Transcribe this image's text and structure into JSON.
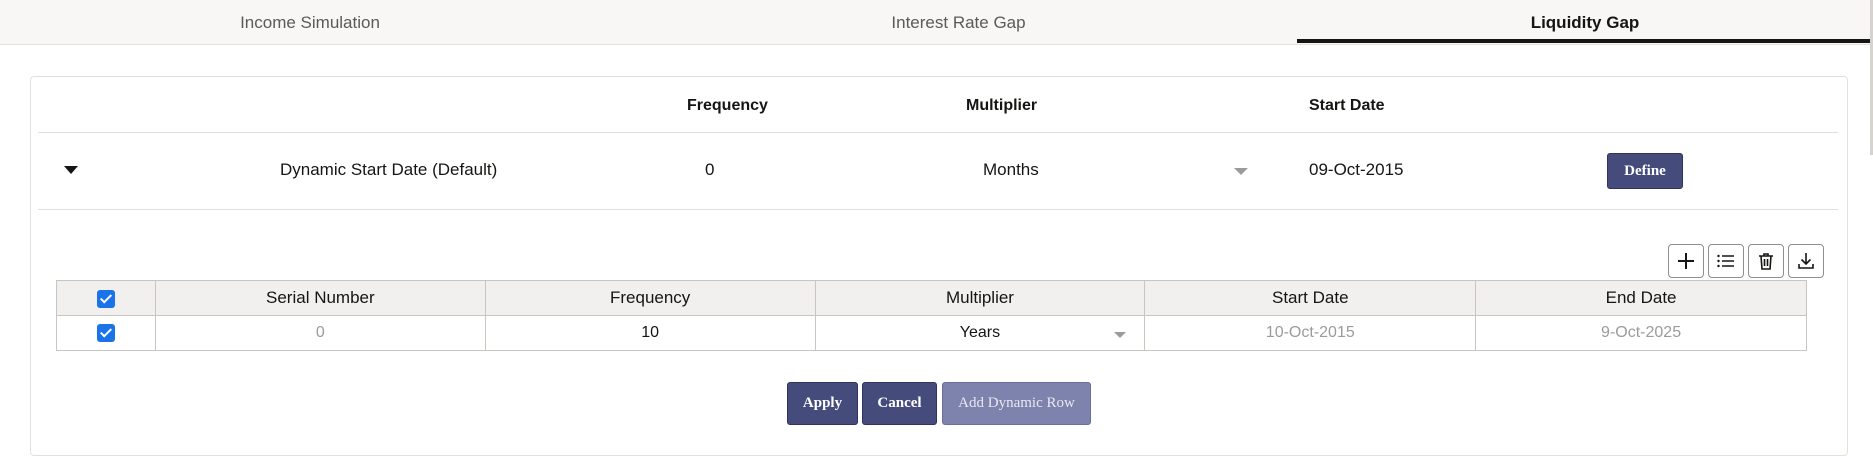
{
  "tabs": [
    {
      "label": "Income Simulation"
    },
    {
      "label": "Interest Rate Gap"
    },
    {
      "label": "Liquidity Gap"
    }
  ],
  "header": {
    "frequency": "Frequency",
    "multiplier": "Multiplier",
    "start_date": "Start Date"
  },
  "dynamic_row": {
    "label": "Dynamic Start Date (Default)",
    "frequency": "0",
    "multiplier": "Months",
    "start_date": "09-Oct-2015",
    "define_label": "Define"
  },
  "toolbar": {
    "add_icon": "plus-icon",
    "list_icon": "list-icon",
    "delete_icon": "trash-icon",
    "export_icon": "download-icon"
  },
  "grid": {
    "columns": [
      "Serial Number",
      "Frequency",
      "Multiplier",
      "Start Date",
      "End Date"
    ],
    "rows": [
      {
        "serial": "0",
        "frequency": "10",
        "multiplier": "Years",
        "start_date": "10-Oct-2015",
        "end_date": "9-Oct-2025"
      }
    ]
  },
  "actions": {
    "apply": "Apply",
    "cancel": "Cancel",
    "add_dynamic_row": "Add Dynamic Row"
  },
  "colors": {
    "primary_button": "#454b7a",
    "checkbox": "#1a73e8",
    "active_tab_underline": "#161513"
  }
}
